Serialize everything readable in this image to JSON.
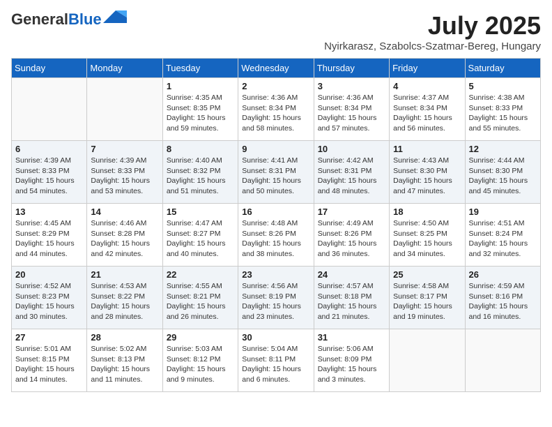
{
  "logo": {
    "general": "General",
    "blue": "Blue"
  },
  "title": {
    "month_year": "July 2025",
    "location": "Nyirkarasz, Szabolcs-Szatmar-Bereg, Hungary"
  },
  "weekdays": [
    "Sunday",
    "Monday",
    "Tuesday",
    "Wednesday",
    "Thursday",
    "Friday",
    "Saturday"
  ],
  "weeks": [
    [
      {
        "day": "",
        "info": ""
      },
      {
        "day": "",
        "info": ""
      },
      {
        "day": "1",
        "info": "Sunrise: 4:35 AM\nSunset: 8:35 PM\nDaylight: 15 hours and 59 minutes."
      },
      {
        "day": "2",
        "info": "Sunrise: 4:36 AM\nSunset: 8:34 PM\nDaylight: 15 hours and 58 minutes."
      },
      {
        "day": "3",
        "info": "Sunrise: 4:36 AM\nSunset: 8:34 PM\nDaylight: 15 hours and 57 minutes."
      },
      {
        "day": "4",
        "info": "Sunrise: 4:37 AM\nSunset: 8:34 PM\nDaylight: 15 hours and 56 minutes."
      },
      {
        "day": "5",
        "info": "Sunrise: 4:38 AM\nSunset: 8:33 PM\nDaylight: 15 hours and 55 minutes."
      }
    ],
    [
      {
        "day": "6",
        "info": "Sunrise: 4:39 AM\nSunset: 8:33 PM\nDaylight: 15 hours and 54 minutes."
      },
      {
        "day": "7",
        "info": "Sunrise: 4:39 AM\nSunset: 8:33 PM\nDaylight: 15 hours and 53 minutes."
      },
      {
        "day": "8",
        "info": "Sunrise: 4:40 AM\nSunset: 8:32 PM\nDaylight: 15 hours and 51 minutes."
      },
      {
        "day": "9",
        "info": "Sunrise: 4:41 AM\nSunset: 8:31 PM\nDaylight: 15 hours and 50 minutes."
      },
      {
        "day": "10",
        "info": "Sunrise: 4:42 AM\nSunset: 8:31 PM\nDaylight: 15 hours and 48 minutes."
      },
      {
        "day": "11",
        "info": "Sunrise: 4:43 AM\nSunset: 8:30 PM\nDaylight: 15 hours and 47 minutes."
      },
      {
        "day": "12",
        "info": "Sunrise: 4:44 AM\nSunset: 8:30 PM\nDaylight: 15 hours and 45 minutes."
      }
    ],
    [
      {
        "day": "13",
        "info": "Sunrise: 4:45 AM\nSunset: 8:29 PM\nDaylight: 15 hours and 44 minutes."
      },
      {
        "day": "14",
        "info": "Sunrise: 4:46 AM\nSunset: 8:28 PM\nDaylight: 15 hours and 42 minutes."
      },
      {
        "day": "15",
        "info": "Sunrise: 4:47 AM\nSunset: 8:27 PM\nDaylight: 15 hours and 40 minutes."
      },
      {
        "day": "16",
        "info": "Sunrise: 4:48 AM\nSunset: 8:26 PM\nDaylight: 15 hours and 38 minutes."
      },
      {
        "day": "17",
        "info": "Sunrise: 4:49 AM\nSunset: 8:26 PM\nDaylight: 15 hours and 36 minutes."
      },
      {
        "day": "18",
        "info": "Sunrise: 4:50 AM\nSunset: 8:25 PM\nDaylight: 15 hours and 34 minutes."
      },
      {
        "day": "19",
        "info": "Sunrise: 4:51 AM\nSunset: 8:24 PM\nDaylight: 15 hours and 32 minutes."
      }
    ],
    [
      {
        "day": "20",
        "info": "Sunrise: 4:52 AM\nSunset: 8:23 PM\nDaylight: 15 hours and 30 minutes."
      },
      {
        "day": "21",
        "info": "Sunrise: 4:53 AM\nSunset: 8:22 PM\nDaylight: 15 hours and 28 minutes."
      },
      {
        "day": "22",
        "info": "Sunrise: 4:55 AM\nSunset: 8:21 PM\nDaylight: 15 hours and 26 minutes."
      },
      {
        "day": "23",
        "info": "Sunrise: 4:56 AM\nSunset: 8:19 PM\nDaylight: 15 hours and 23 minutes."
      },
      {
        "day": "24",
        "info": "Sunrise: 4:57 AM\nSunset: 8:18 PM\nDaylight: 15 hours and 21 minutes."
      },
      {
        "day": "25",
        "info": "Sunrise: 4:58 AM\nSunset: 8:17 PM\nDaylight: 15 hours and 19 minutes."
      },
      {
        "day": "26",
        "info": "Sunrise: 4:59 AM\nSunset: 8:16 PM\nDaylight: 15 hours and 16 minutes."
      }
    ],
    [
      {
        "day": "27",
        "info": "Sunrise: 5:01 AM\nSunset: 8:15 PM\nDaylight: 15 hours and 14 minutes."
      },
      {
        "day": "28",
        "info": "Sunrise: 5:02 AM\nSunset: 8:13 PM\nDaylight: 15 hours and 11 minutes."
      },
      {
        "day": "29",
        "info": "Sunrise: 5:03 AM\nSunset: 8:12 PM\nDaylight: 15 hours and 9 minutes."
      },
      {
        "day": "30",
        "info": "Sunrise: 5:04 AM\nSunset: 8:11 PM\nDaylight: 15 hours and 6 minutes."
      },
      {
        "day": "31",
        "info": "Sunrise: 5:06 AM\nSunset: 8:09 PM\nDaylight: 15 hours and 3 minutes."
      },
      {
        "day": "",
        "info": ""
      },
      {
        "day": "",
        "info": ""
      }
    ]
  ]
}
